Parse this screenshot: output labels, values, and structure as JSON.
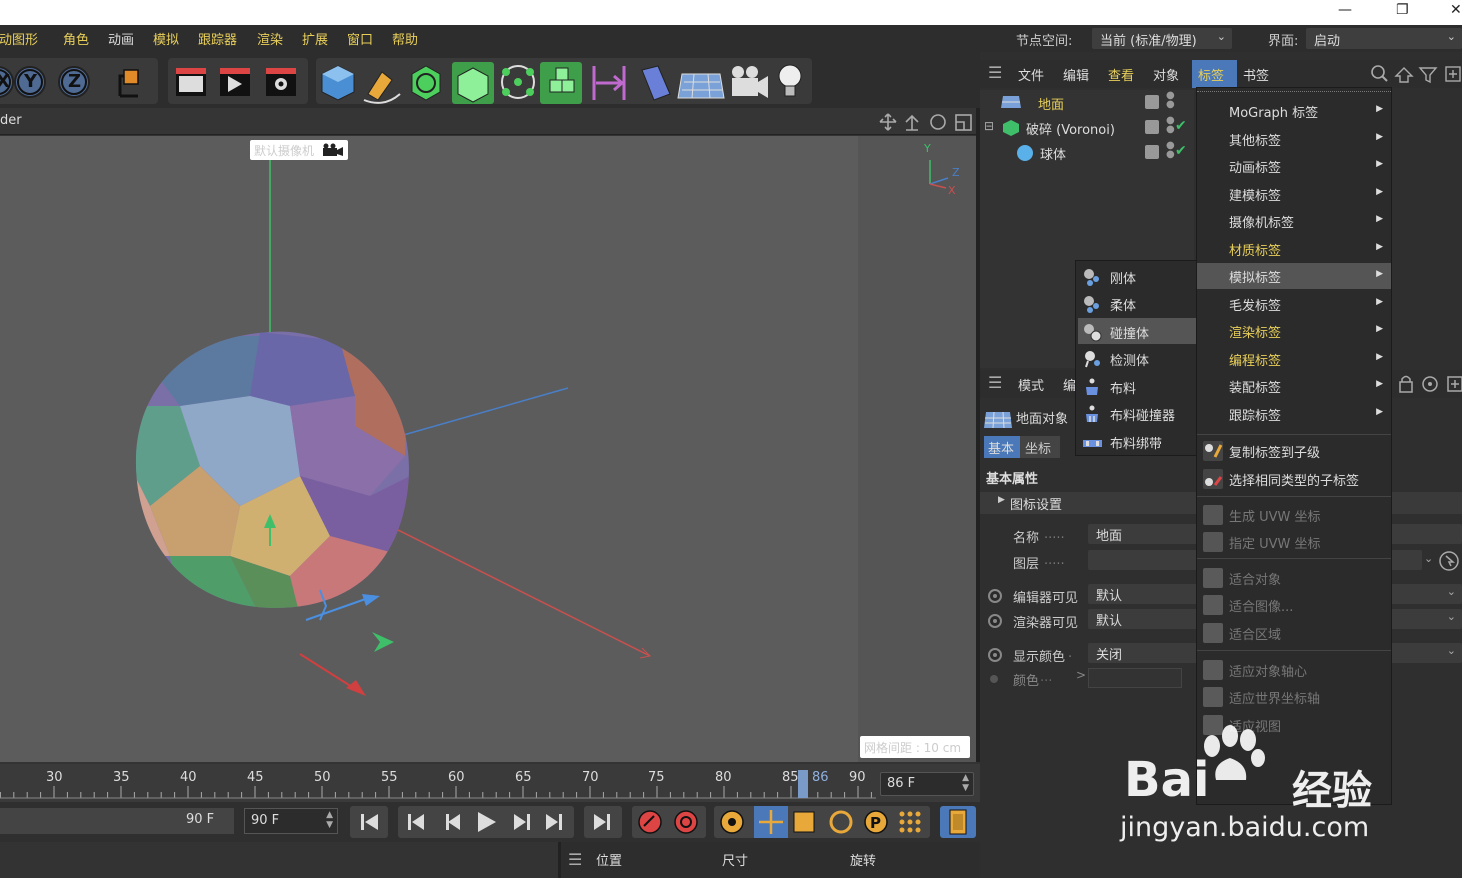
{
  "window": {
    "restore_glyph": "❐",
    "close_glyph": "✕",
    "minimize_glyph": "—"
  },
  "menubar": {
    "items": [
      "运动图形",
      "角色",
      "动画",
      "模拟",
      "跟踪器",
      "渲染",
      "扩展",
      "窗口",
      "帮助"
    ]
  },
  "nodebar": {
    "node_space_label": "节点空间:",
    "node_space_value": "当前 (标准/物理)",
    "interface_label": "界面:",
    "interface_value": "启动"
  },
  "toolbar": {
    "axis_x": "X",
    "axis_y": "Y",
    "axis_z": "Z"
  },
  "viewport": {
    "header_label": "der",
    "camera_label": "默认摄像机",
    "grid_label": "网格间距 : 10 cm",
    "axis_y": "Y",
    "axis_z": "Z",
    "axis_x": "X"
  },
  "timeline": {
    "ticks": [
      "30",
      "35",
      "40",
      "45",
      "50",
      "55",
      "60",
      "65",
      "70",
      "75",
      "80",
      "85",
      "86",
      "90"
    ],
    "current_frame": "86 F",
    "end_frame": "90 F",
    "end_frame_field": "90 F",
    "playhead_value": 86
  },
  "coordbar": {
    "position": "位置",
    "size": "尺寸",
    "rotation": "旋转"
  },
  "object_manager": {
    "menu": [
      "文件",
      "编辑",
      "查看",
      "对象",
      "标签",
      "书签"
    ],
    "objects": [
      {
        "name": "地面",
        "color": "#e8cf5a"
      },
      {
        "name": "破碎 (Voronoi)",
        "color": "#ddd"
      },
      {
        "name": "球体",
        "color": "#ddd"
      }
    ]
  },
  "attributes": {
    "menu_mode": "模式",
    "menu_edit": "编",
    "object_title": "地面对象",
    "tabs": [
      "基本",
      "坐标"
    ],
    "section": "基本属性",
    "subsection": "图标设置",
    "name_label": "名称",
    "name_value": "地面",
    "layer_label": "图层",
    "editor_visible_label": "编辑器可见",
    "editor_visible_value": "默认",
    "render_visible_label": "渲染器可见",
    "render_visible_value": "默认",
    "display_color_label": "显示颜色",
    "display_color_value": "关闭",
    "color_label": "颜色"
  },
  "tags_menu": {
    "items": [
      {
        "label": "MoGraph 标签",
        "color": "#ddd",
        "sub": true
      },
      {
        "label": "其他标签",
        "color": "#ddd",
        "sub": true
      },
      {
        "label": "动画标签",
        "color": "#ddd",
        "sub": true
      },
      {
        "label": "建模标签",
        "color": "#ddd",
        "sub": true
      },
      {
        "label": "摄像机标签",
        "color": "#ddd",
        "sub": true
      },
      {
        "label": "材质标签",
        "color": "#e8cf5a",
        "sub": true
      },
      {
        "label": "模拟标签",
        "color": "#ddd",
        "sub": true,
        "highlight": true
      },
      {
        "label": "毛发标签",
        "color": "#ddd",
        "sub": true
      },
      {
        "label": "渲染标签",
        "color": "#e8cf5a",
        "sub": true
      },
      {
        "label": "编程标签",
        "color": "#e8cf5a",
        "sub": true
      },
      {
        "label": "装配标签",
        "color": "#ddd",
        "sub": true
      },
      {
        "label": "跟踪标签",
        "color": "#ddd",
        "sub": true
      }
    ],
    "actions": [
      "复制标签到子级",
      "选择相同类型的子标签"
    ],
    "disabled": [
      "生成 UVW 坐标",
      "指定 UVW 坐标",
      "适合对象",
      "适合图像...",
      "适合区域",
      "适应对象轴心",
      "适应世界坐标轴",
      "适应视图"
    ]
  },
  "sim_menu": {
    "items": [
      "刚体",
      "柔体",
      "碰撞体",
      "检测体",
      "布料",
      "布料碰撞器",
      "布料绑带"
    ],
    "highlight_index": 2
  },
  "watermark": {
    "brand": "Bai",
    "brand2": "经验",
    "url": "jingyan.baidu.com"
  }
}
